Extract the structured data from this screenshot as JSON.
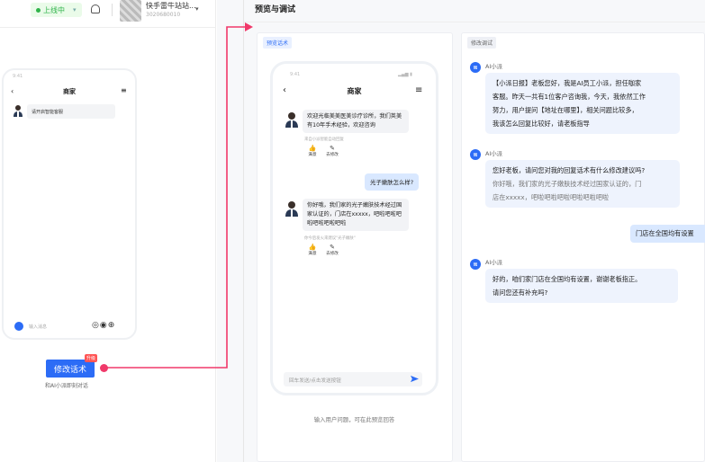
{
  "header": {
    "status_label": "上线中",
    "shop_name": "快手雷牛站站...",
    "shop_id": "3020680010"
  },
  "mini_phone": {
    "status_time": "9:41",
    "title": "商家",
    "bubble_text": "请开启智能客服",
    "input_placeholder": "输入消息",
    "action_glyphs": "◎◉⊕"
  },
  "edit_button": {
    "label": "修改话术",
    "badge": "升级",
    "subtext": "和AI小派即刻对话"
  },
  "page": {
    "title": "预览与调试"
  },
  "preview_panel": {
    "tag": "预览话术",
    "status_time": "9:41",
    "status_icons": "▂▄▆ ▮",
    "title": "商家",
    "messages": [
      {
        "text": "欢迎光临美美医美诊疗诊所，我们英美有10年手术经验，欢迎咨询",
        "hint": "来自小派智能自动回复",
        "actions": [
          {
            "icon": "👍",
            "label": "满意"
          },
          {
            "icon": "✎",
            "label": "去修改"
          }
        ]
      },
      {
        "text": "你好哦，我们家的光子嫩肤技术经过国家认证的，门店在xxxxx，吧啦吧啦吧啦吧啦吧啦吧啦",
        "hint": "你今后发火来建议\"光子嫩肤\"",
        "actions": [
          {
            "icon": "👍",
            "label": "满意"
          },
          {
            "icon": "✎",
            "label": "去修改"
          }
        ]
      }
    ],
    "user_message": "光子嫩肤怎么样?",
    "input_placeholder": "回车发送/点击发送按钮",
    "footer": "输入用户问题，可在此预览回答"
  },
  "edit_panel": {
    "tag": "修改调试",
    "ai_name": "AI小派",
    "messages": [
      {
        "lines": [
          "【小派日报】老板您好，我是AI员工小派，担任咖家",
          "客服。昨天一共有1位客户咨询我，今天，我依然工作",
          "努力，用户提问【地址在哪里】，相关问题比较多，",
          "我该怎么回复比较好，请老板指导"
        ]
      },
      {
        "lines": [
          "您好老板，请问您对我的回复话术有什么修改建议吗?"
        ],
        "muted_lines": [
          "你好哦，我们家的光子嫩肤技术经过国家认证的，门",
          "店在xxxxx，吧啦吧啦吧啦吧啦吧啦吧啦"
        ]
      },
      {
        "lines": [
          "好的，咱们家门店在全国均有设置，谢谢老板指正。",
          "请问您还有补充吗?"
        ]
      }
    ],
    "user_message": "门店在全国均有设置"
  }
}
